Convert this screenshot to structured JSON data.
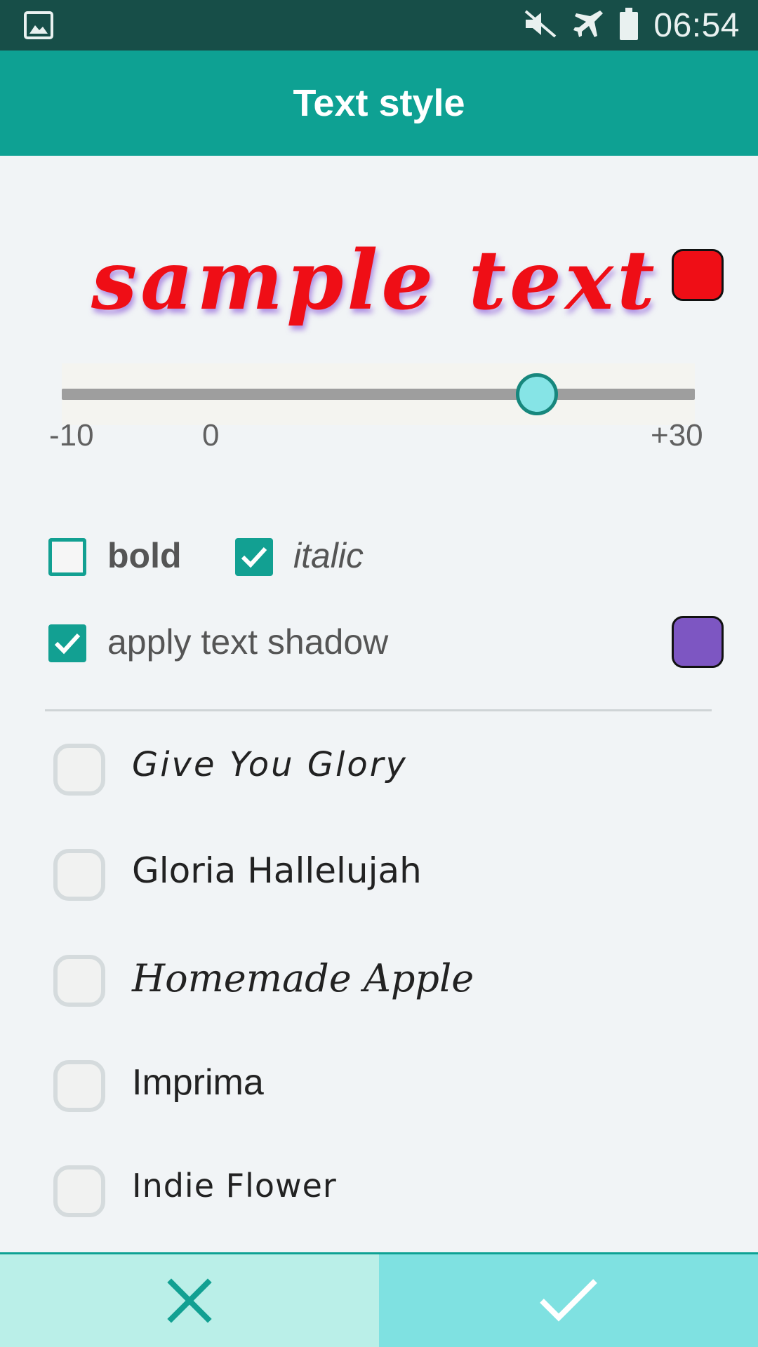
{
  "status_bar": {
    "time": "06:54",
    "icons": [
      "image-icon",
      "mute-icon",
      "airplane-mode-icon",
      "battery-icon"
    ]
  },
  "app_bar": {
    "title": "Text style"
  },
  "preview": {
    "sample_text": "sample text",
    "text_color": "#ef0e16",
    "shadow_color": "#7d56c2"
  },
  "size_slider": {
    "min_label": "-10",
    "zero_label": "0",
    "max_label": "+30",
    "min": -10,
    "max": 30,
    "value": 20
  },
  "style_options": {
    "bold": {
      "label": "bold",
      "checked": false
    },
    "italic": {
      "label": "italic",
      "checked": true
    },
    "shadow": {
      "label": "apply text shadow",
      "checked": true
    }
  },
  "fonts": [
    {
      "name": "Give You Glory",
      "selected": false
    },
    {
      "name": "Gloria Hallelujah",
      "selected": false
    },
    {
      "name": "Homemade Apple",
      "selected": false
    },
    {
      "name": "Imprima",
      "selected": false
    },
    {
      "name": "Indie Flower",
      "selected": false
    }
  ],
  "colors": {
    "status_bar": "#174e48",
    "app_bar": "#0ea193",
    "accent": "#12a092",
    "cancel_bg": "#baefe8",
    "confirm_bg": "#7fe1e1"
  },
  "actions": {
    "cancel": "close-icon",
    "confirm": "check-icon"
  }
}
